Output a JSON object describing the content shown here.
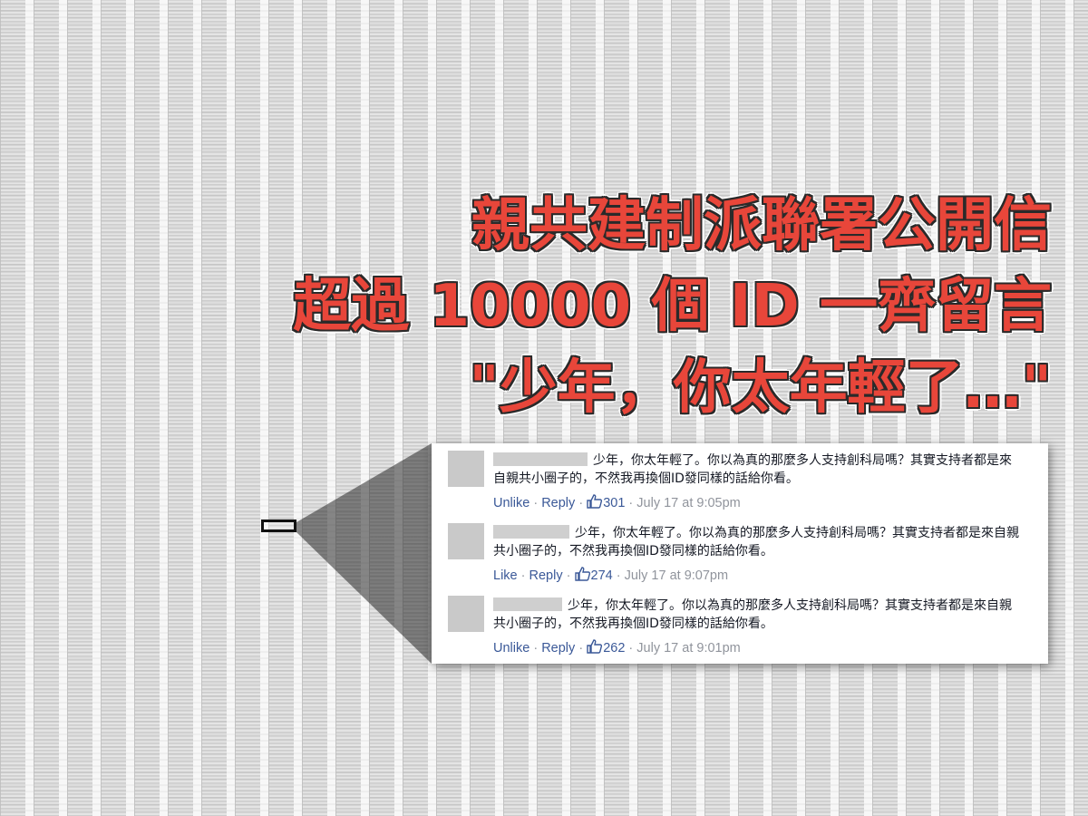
{
  "headline": {
    "line1": "親共建制派聯署公開信",
    "line2": "超過 10000 個 ID 一齊留言",
    "line3": "\"少年，你太年輕了…\""
  },
  "colors": {
    "headline_fill": "#e8463a",
    "headline_outline": "#2a2a2a",
    "link": "#3b5998",
    "meta_gray": "#90949c",
    "comment_text": "#141823"
  },
  "comments": [
    {
      "text": "少年，你太年輕了。你以為真的那麼多人支持創科局嗎？其實支持者都是來自親共小圈子的，不然我再換個ID發同樣的話給你看。",
      "action": "Unlike",
      "reply": "Reply",
      "likes": "301",
      "timestamp": "July 17 at 9:05pm",
      "separator": "·",
      "like_icon": "thumbs-up-icon"
    },
    {
      "text": "少年，你太年輕了。你以為真的那麼多人支持創科局嗎？其實支持者都是來自親共小圈子的，不然我再換個ID發同樣的話給你看。",
      "action": "Like",
      "reply": "Reply",
      "likes": "274",
      "timestamp": "July 17 at 9:07pm",
      "separator": "·",
      "like_icon": "thumbs-up-icon"
    },
    {
      "text": "少年，你太年輕了。你以為真的那麼多人支持創科局嗎？其實支持者都是來自親共小圈子的，不然我再換個ID發同樣的話給你看。",
      "action": "Unlike",
      "reply": "Reply",
      "likes": "262",
      "timestamp": "July 17 at 9:01pm",
      "separator": "·",
      "like_icon": "thumbs-up-icon"
    }
  ]
}
